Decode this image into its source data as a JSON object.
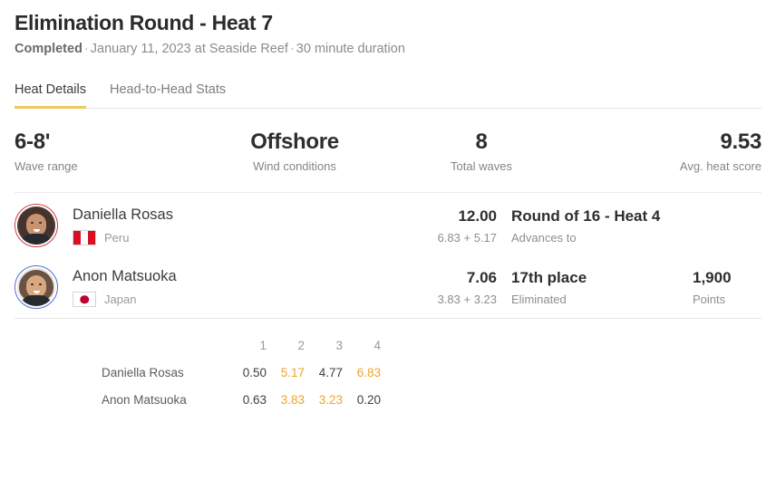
{
  "header": {
    "title": "Elimination Round - Heat 7",
    "status": "Completed",
    "separator": "·",
    "date_location": "January 11, 2023 at Seaside Reef",
    "duration": "30 minute duration"
  },
  "tabs": [
    {
      "label": "Heat Details",
      "active": true
    },
    {
      "label": "Head-to-Head Stats",
      "active": false
    }
  ],
  "stats": [
    {
      "value": "6-8'",
      "label": "Wave range",
      "align": "left"
    },
    {
      "value": "Offshore",
      "label": "Wind conditions",
      "align": "center"
    },
    {
      "value": "8",
      "label": "Total waves",
      "align": "center"
    },
    {
      "value": "9.53",
      "label": "Avg. heat score",
      "align": "right"
    }
  ],
  "athletes": [
    {
      "name": "Daniella Rosas",
      "country": "Peru",
      "flag": "peru-flag",
      "ring_color": "#d73a3a",
      "total_score": "12.00",
      "score_breakdown": "6.83 + 5.17",
      "result": "Round of 16 - Heat 4",
      "result_label": "Advances to",
      "points": "",
      "points_label": ""
    },
    {
      "name": "Anon Matsuoka",
      "country": "Japan",
      "flag": "japan-flag",
      "ring_color": "#4a72d4",
      "total_score": "7.06",
      "score_breakdown": "3.83 + 3.23",
      "result": "17th place",
      "result_label": "Eliminated",
      "points": "1,900",
      "points_label": "Points"
    }
  ],
  "wave_table": {
    "wave_numbers": [
      "1",
      "2",
      "3",
      "4"
    ],
    "rows": [
      {
        "athlete": "Daniella Rosas",
        "scores": [
          {
            "value": "0.50",
            "counted": false
          },
          {
            "value": "5.17",
            "counted": true
          },
          {
            "value": "4.77",
            "counted": false
          },
          {
            "value": "6.83",
            "counted": true
          }
        ]
      },
      {
        "athlete": "Anon Matsuoka",
        "scores": [
          {
            "value": "0.63",
            "counted": false
          },
          {
            "value": "3.83",
            "counted": true
          },
          {
            "value": "3.23",
            "counted": true
          },
          {
            "value": "0.20",
            "counted": false
          }
        ]
      }
    ]
  },
  "colors": {
    "accent_tab_underline": "#eec95c",
    "counted_score": "#f0a32a",
    "title": "#2b2b2b",
    "muted": "#8c8c8c",
    "divider": "#e9e9e9"
  }
}
